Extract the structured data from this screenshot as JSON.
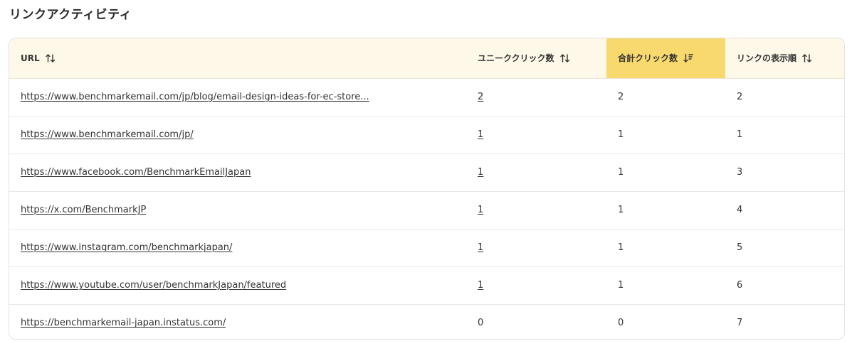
{
  "page": {
    "title": "リンクアクティビティ"
  },
  "table": {
    "columns": [
      {
        "key": "url",
        "label": "URL",
        "sort_icon": "sort-both-icon",
        "active": false
      },
      {
        "key": "unique_clicks",
        "label": "ユニーククリック数",
        "sort_icon": "sort-both-icon",
        "active": false
      },
      {
        "key": "total_clicks",
        "label": "合計クリック数",
        "sort_icon": "sort-desc-icon",
        "active": true
      },
      {
        "key": "display_order",
        "label": "リンクの表示順",
        "sort_icon": "sort-both-icon",
        "active": false
      }
    ],
    "rows": [
      {
        "url": "https://www.benchmarkemail.com/jp/blog/email-design-ideas-for-ec-store...",
        "unique_clicks": "2",
        "total_clicks": "2",
        "display_order": "2"
      },
      {
        "url": "https://www.benchmarkemail.com/jp/",
        "unique_clicks": "1",
        "total_clicks": "1",
        "display_order": "1"
      },
      {
        "url": "https://www.facebook.com/BenchmarkEmailJapan",
        "unique_clicks": "1",
        "total_clicks": "1",
        "display_order": "3"
      },
      {
        "url": "https://x.com/BenchmarkJP",
        "unique_clicks": "1",
        "total_clicks": "1",
        "display_order": "4"
      },
      {
        "url": "https://www.instagram.com/benchmarkjapan/",
        "unique_clicks": "1",
        "total_clicks": "1",
        "display_order": "5"
      },
      {
        "url": "https://www.youtube.com/user/benchmarkJapan/featured",
        "unique_clicks": "1",
        "total_clicks": "1",
        "display_order": "6"
      },
      {
        "url": "https://benchmarkemail-japan.instatus.com/",
        "unique_clicks": "0",
        "total_clicks": "0",
        "display_order": "7"
      }
    ]
  },
  "colors": {
    "header_bg": "#fdf8e8",
    "active_header_bg": "#f7d96e",
    "border": "#e3e3e3"
  }
}
